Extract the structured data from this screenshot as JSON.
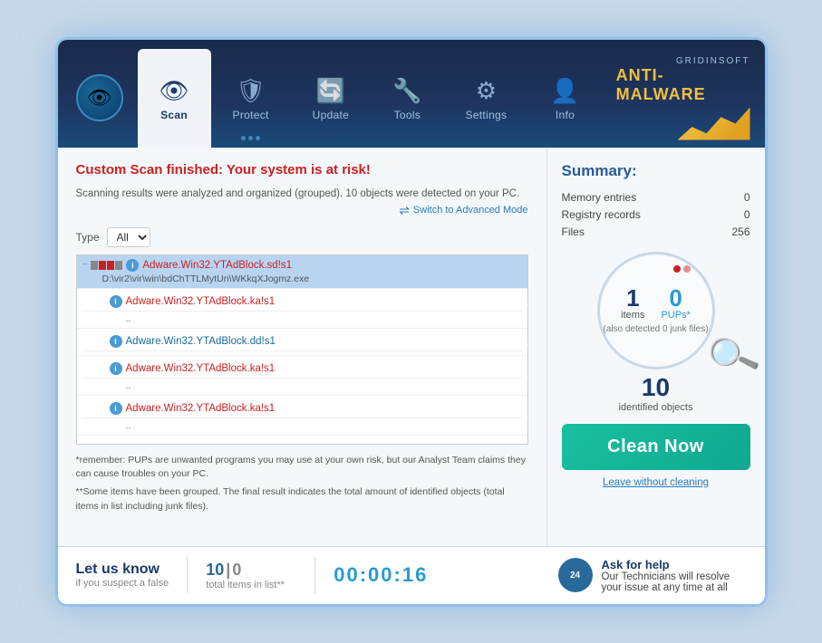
{
  "app": {
    "brand_small": "GRIDINSOFT",
    "brand_large": "ANTI-MALWARE"
  },
  "nav": {
    "items": [
      {
        "id": "scan",
        "label": "Scan",
        "icon": "👁",
        "active": true
      },
      {
        "id": "protect",
        "label": "Protect",
        "icon": "🛡",
        "active": false
      },
      {
        "id": "update",
        "label": "Update",
        "icon": "🔄",
        "active": false
      },
      {
        "id": "tools",
        "label": "Tools",
        "icon": "🔧",
        "active": false
      },
      {
        "id": "settings",
        "label": "Settings",
        "icon": "⚙",
        "active": false
      },
      {
        "id": "info",
        "label": "Info",
        "icon": "👤",
        "active": false
      }
    ]
  },
  "scan": {
    "title_static": "Custom Scan finished: ",
    "title_alert": "Your system is at risk!",
    "subtitle": "Scanning results were analyzed and organized (grouped). 10 objects were detected on your PC.",
    "advanced_link": "Switch to Advanced Mode",
    "filter_label": "Type",
    "filter_value": "All",
    "results": [
      {
        "id": 1,
        "selected": true,
        "name": "Adware.Win32.YTAdBlock.sd!s1",
        "path": "D:\\vir2\\vir\\win\\bdChTTLMytUn\\WKkqXJogmz.exe",
        "expanded": true,
        "subitems": []
      },
      {
        "id": 2,
        "selected": false,
        "name": "Adware.Win32.YTAdBlock.ka!s1",
        "path": "..",
        "expanded": false,
        "subitems": []
      },
      {
        "id": 3,
        "selected": false,
        "name": "Adware.Win32.YTAdBlock.dd!s1",
        "path": "",
        "expanded": false,
        "subitems": []
      },
      {
        "id": 4,
        "selected": false,
        "name": "Adware.Win32.YTAdBlock.ka!s1",
        "path": "..",
        "expanded": false,
        "subitems": []
      },
      {
        "id": 5,
        "selected": false,
        "name": "Adware.Win32.YTAdBlock.ka!s1",
        "path": "..",
        "expanded": false,
        "subitems": []
      }
    ],
    "footnote1": "*remember: PUPs are unwanted programs you may use at your own risk, but our Analyst Team claims they can cause troubles on your PC.",
    "footnote2": "**Some items have been grouped. The final result indicates the total amount of identified objects (total items in list including junk files)."
  },
  "summary": {
    "title": "Summary:",
    "memory_label": "Memory entries",
    "memory_value": "0",
    "registry_label": "Registry records",
    "registry_value": "0",
    "files_label": "Files",
    "files_value": "256",
    "items_num": "1",
    "items_label": "items",
    "pups_num": "0",
    "pups_label": "PUPs*",
    "also_text": "(also detected 0 junk files)",
    "identified_num": "10",
    "identified_label": "identified objects",
    "clean_btn": "Clean Now",
    "leave_link": "Leave without cleaning"
  },
  "bottom": {
    "letusknow_title": "Let us know",
    "letusknow_sub": "if you suspect a false",
    "count_items": "10",
    "count_sep": "|",
    "count_zero": "0",
    "count_sub": "total items in list**",
    "timer": "00:00:16",
    "help_title": "Ask for help",
    "help_text": "Our Technicians will resolve your issue at any time at all"
  }
}
